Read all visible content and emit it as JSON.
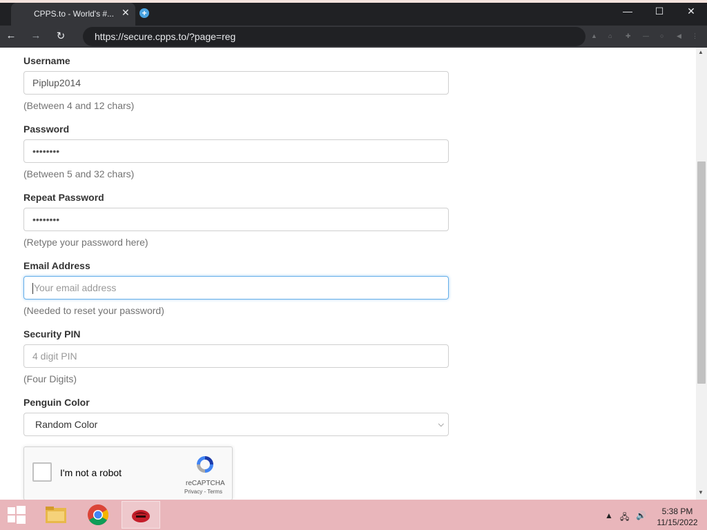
{
  "browser": {
    "tab_title": "CPPS.to - World's #...",
    "url": "https://secure.cpps.to/?page=reg"
  },
  "form": {
    "username": {
      "label": "Username",
      "value": "Piplup2014",
      "help": "(Between 4 and 12 chars)"
    },
    "password": {
      "label": "Password",
      "value": "••••••••",
      "help": "(Between 5 and 32 chars)"
    },
    "repeat_password": {
      "label": "Repeat Password",
      "value": "••••••••",
      "help": "(Retype your password here)"
    },
    "email": {
      "label": "Email Address",
      "placeholder": "Your email address",
      "help": "(Needed to reset your password)"
    },
    "pin": {
      "label": "Security PIN",
      "placeholder": "4 digit PIN",
      "help": "(Four Digits)"
    },
    "color": {
      "label": "Penguin Color",
      "selected": "Random Color"
    }
  },
  "captcha": {
    "label": "I'm not a robot",
    "brand": "reCAPTCHA",
    "links": "Privacy - Terms"
  },
  "taskbar": {
    "time": "5:38 PM",
    "date": "11/15/2022"
  },
  "colors": {
    "focus_border": "#66afe9",
    "taskbar": "#e9b6bb",
    "browser_dark": "#202124"
  }
}
